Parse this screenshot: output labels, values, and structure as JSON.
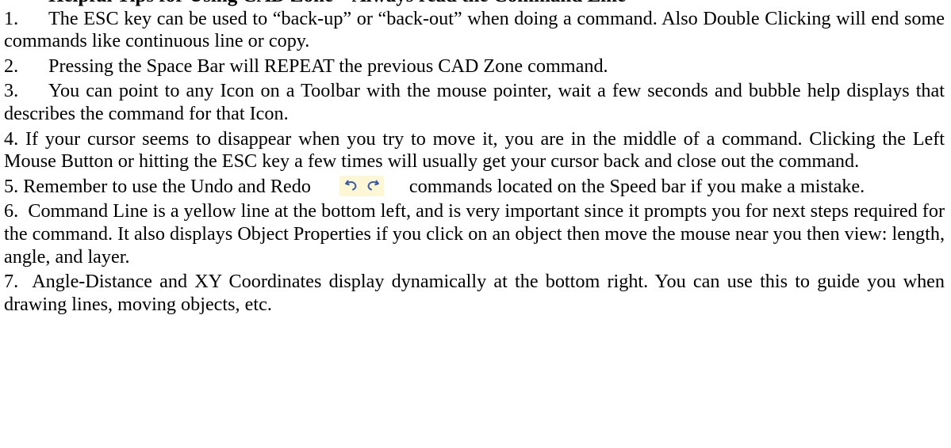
{
  "heading": "Helpful Tips for Using CAD Zone – Always read the Command Line",
  "items": [
    {
      "num": "1.",
      "text": "The ESC key can be used to “back-up” or “back-out” when doing a command. Also Double Clicking will end some commands like continuous line or copy."
    },
    {
      "num": "2.",
      "text": "Pressing the Space Bar will REPEAT the previous CAD Zone command."
    },
    {
      "num": "3.",
      "text": "You can point to any Icon on a Toolbar with the mouse pointer, wait a few seconds and bubble help displays that describes the command for that Icon."
    },
    {
      "num": "4.",
      "text": "If your cursor seems to disappear when you try to move it, you are in the middle of a command.  Clicking the Left Mouse Button or hitting the ESC key a few times will usually get your cursor back and close out the command."
    },
    {
      "num": "5.",
      "text_before": "Remember to use the Undo and Redo",
      "text_after": "commands located on the Speed bar if you make a mistake.",
      "icons": [
        "undo-icon",
        "redo-icon"
      ],
      "icon_background": "#fdf7d6",
      "icon_color": "#3a5fa8"
    },
    {
      "num": "6.",
      "text": "Command Line is a yellow line at the bottom left, and is very important since it prompts you for next steps required for the command. It also displays Object Properties if you click on an object then move the mouse near you then view: length, angle, and layer."
    },
    {
      "num": "7.",
      "text": "Angle-Distance and XY Coordinates display dynamically at the bottom right.  You can use this to guide you when drawing lines, moving objects, etc."
    }
  ]
}
